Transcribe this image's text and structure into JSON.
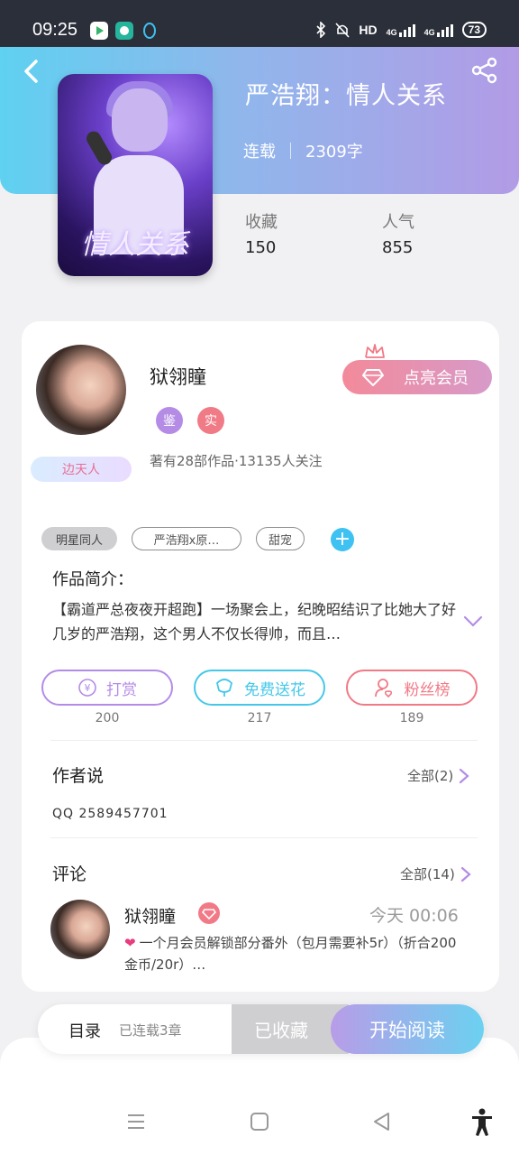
{
  "status_bar": {
    "time": "09:25",
    "network_label": "HD",
    "signal_1": "4G",
    "signal_2": "4G",
    "battery": "73",
    "icons": [
      "video-app-icon",
      "chat-app-icon",
      "qq-penguin-icon",
      "bluetooth-icon",
      "mute-icon",
      "signal-icon",
      "battery-icon"
    ]
  },
  "book": {
    "title": "严浩翔：情人关系",
    "status": "连载",
    "word_count": "2309字",
    "cover_text": "情人关系",
    "favorites_label": "收藏",
    "favorites_value": "150",
    "popularity_label": "人气",
    "popularity_value": "855"
  },
  "author": {
    "name": "狱翎瞳",
    "badge_1": "鉴",
    "badge_2": "实",
    "stats": "著有28部作品·13135人关注",
    "fan_tag": "边天人",
    "vip_button": "点亮会员"
  },
  "tags": [
    "明星同人",
    "严浩翔x原…",
    "甜宠"
  ],
  "intro": {
    "title": "作品简介：",
    "text": "【霸道严总夜夜开超跑】一场聚会上，纪晚昭结识了比她大了好几岁的严浩翔，这个男人不仅长得帅，而且…"
  },
  "actions": [
    {
      "label": "打赏",
      "count": "200",
      "icon": "yuan-coin-icon",
      "color": "#b48ce6"
    },
    {
      "label": "免费送花",
      "count": "217",
      "icon": "flower-icon",
      "color": "#45c8e8"
    },
    {
      "label": "粉丝榜",
      "count": "189",
      "icon": "fan-user-icon",
      "color": "#f07a86"
    }
  ],
  "author_says": {
    "title": "作者说",
    "all_label": "全部(2)",
    "content": "QQ 2589457701"
  },
  "comments": {
    "title": "评论",
    "all_label": "全部(14)",
    "items": [
      {
        "name": "狱翎瞳",
        "time": "今天 00:06",
        "text": "一个月会员解锁部分番外（包月需要补5r）（折合200金币/20r）…"
      }
    ]
  },
  "bottom_bar": {
    "toc_label": "目录",
    "toc_status": "已连载3章",
    "collected_label": "已收藏",
    "read_label": "开始阅读"
  },
  "colors": {
    "accent_purple": "#b48ce6",
    "accent_cyan": "#5fd1f1",
    "accent_pink": "#f07a86"
  }
}
